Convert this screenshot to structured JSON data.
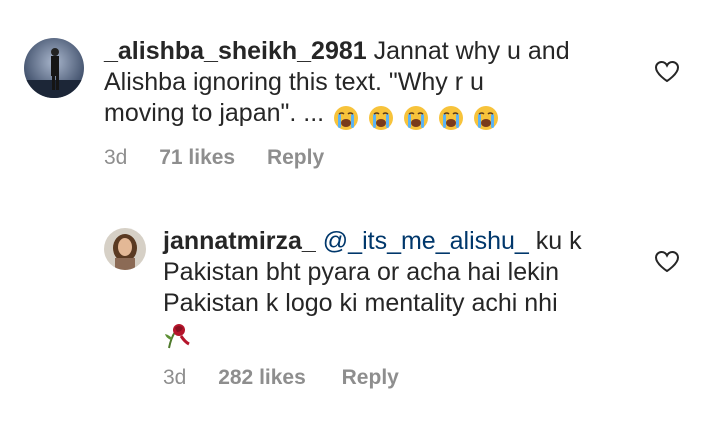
{
  "comments": [
    {
      "username": "_alishba_sheikh_2981",
      "text_line1": "Jannat why u and",
      "text_line2": "Alishba ignoring this text. \"Why r u",
      "text_line3": "moving to japan\". ...",
      "emojis": [
        "loudly-crying-face",
        "loudly-crying-face",
        "loudly-crying-face",
        "loudly-crying-face",
        "loudly-crying-face"
      ],
      "time": "3d",
      "likes": "71 likes",
      "reply_label": "Reply"
    },
    {
      "username": "jannatmirza_",
      "mention": "@_its_me_alishu_",
      "text_line1": "ku k",
      "text_line2": "Pakistan bht pyara or acha hai lekin",
      "text_line3": "Pakistan k logo ki mentality achi nhi",
      "emojis": [
        "wilted-rose"
      ],
      "time": "3d",
      "likes": "282 likes",
      "reply_label": "Reply"
    }
  ],
  "colors": {
    "text": "#262626",
    "secondary": "#8e8e8e",
    "mention": "#00376b"
  }
}
